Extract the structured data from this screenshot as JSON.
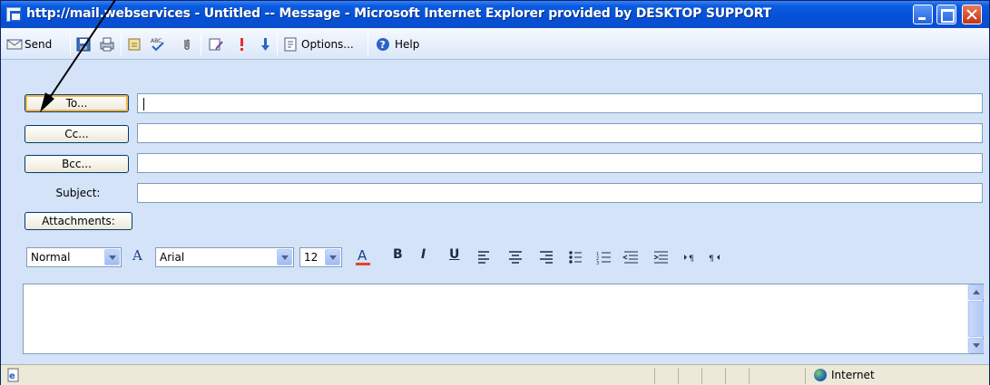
{
  "window": {
    "title": "http://mail.webservices - Untitled -- Message - Microsoft Internet Explorer provided by DESKTOP SUPPORT"
  },
  "toolbar": {
    "send_label": "Send",
    "options_label": "Options...",
    "help_label": "Help",
    "icons": [
      "send-icon",
      "save-icon",
      "print-icon",
      "address-book-icon",
      "spellcheck-icon",
      "attach-icon",
      "signature-icon",
      "high-importance-icon",
      "low-importance-icon",
      "options-icon",
      "help-icon"
    ]
  },
  "header": {
    "to_label": "To...",
    "cc_label": "Cc...",
    "bcc_label": "Bcc...",
    "subject_label": "Subject:",
    "attachments_label": "Attachments:",
    "to_value": "",
    "cc_value": "",
    "bcc_value": "",
    "subject_value": ""
  },
  "format": {
    "style_value": "Normal",
    "font_value": "Arial",
    "size_value": "12",
    "buttons": [
      "B",
      "I",
      "U"
    ]
  },
  "body": {
    "text": ""
  },
  "status": {
    "zone_label": "Internet"
  },
  "colors": {
    "title_bar": "#0550d8",
    "window_bg": "#d4e3f7",
    "close_button": "#c63413"
  }
}
